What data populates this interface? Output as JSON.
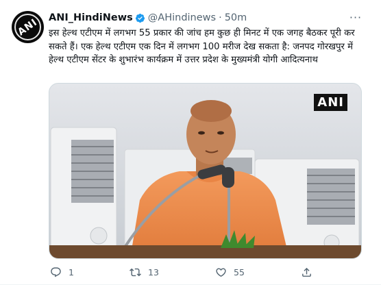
{
  "tweet": {
    "avatar_label": "ANI",
    "display_name": "ANI_HindiNews",
    "handle": "@AHindinews",
    "separator": "·",
    "time": "50m",
    "more_label": "···",
    "text": "इस हेल्थ एटीएम में लगभग 55 प्रकार की जांच हम कुछ ही मिनट में एक जगह बैठकर पूरी कर सकते हैं। एक हेल्थ एटीएम एक दिन में लगभग 100 मरीज देख सकता है: जनपद गोरखपुर में हेल्थ एटीएम सेंटर के शुभारंभ कार्यक्रम में उत्तर प्रदेश के मुख्यमंत्री योगी आदित्यनाथ",
    "media_watermark": "ANI"
  },
  "actions": {
    "reply_count": "1",
    "retweet_count": "13",
    "like_count": "55",
    "share_count": ""
  },
  "colors": {
    "text": "#0f1419",
    "muted": "#536471",
    "verified": "#1d9bf0",
    "border": "#cfd9de"
  },
  "icons": [
    "verified-badge-icon",
    "more-icon",
    "reply-icon",
    "retweet-icon",
    "like-icon",
    "share-icon"
  ]
}
